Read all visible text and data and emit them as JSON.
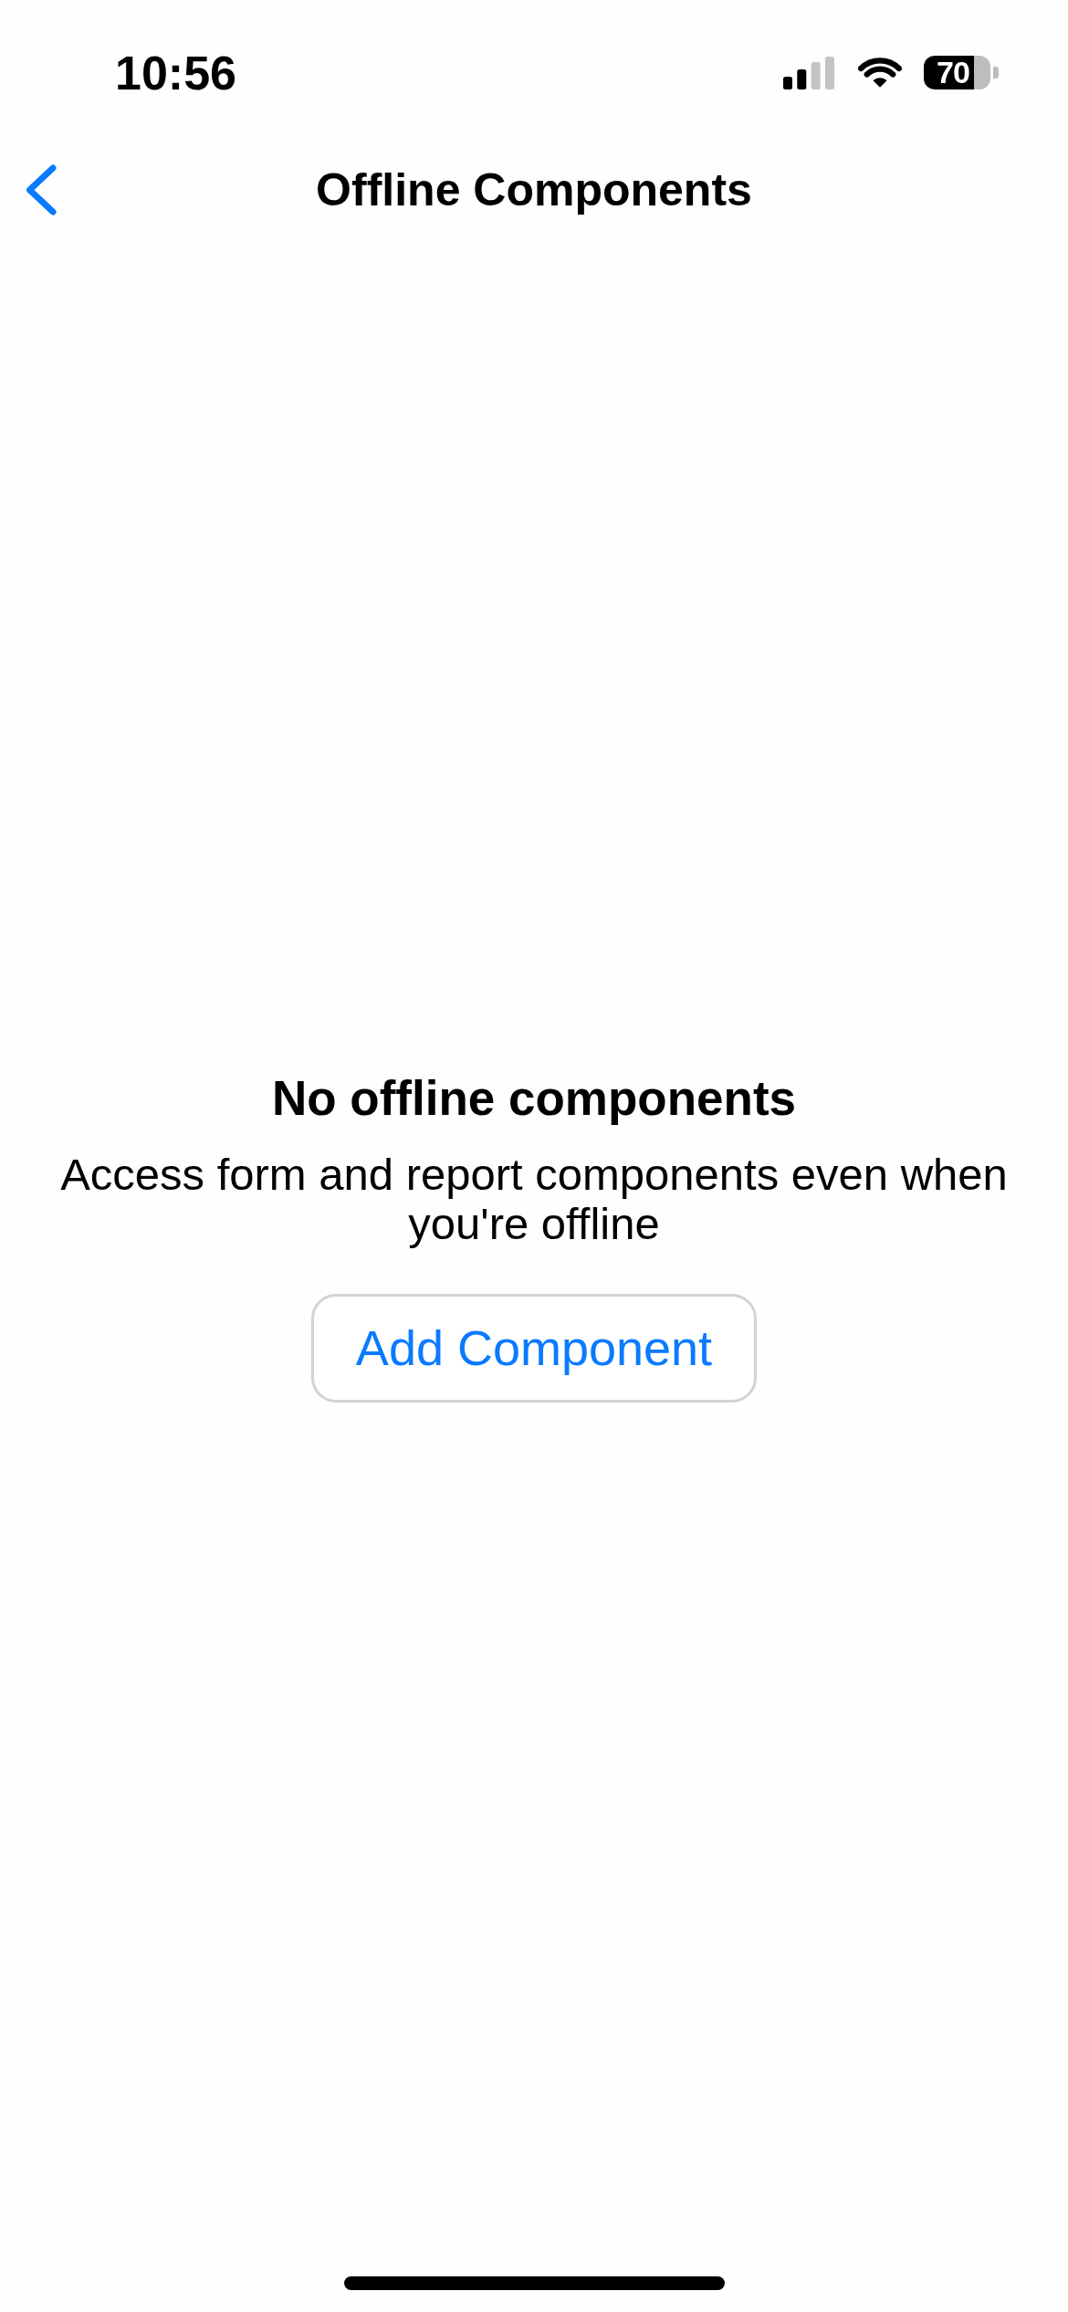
{
  "status_bar": {
    "time": "10:56",
    "battery": "70"
  },
  "nav_bar": {
    "title": "Offline Components"
  },
  "empty_state": {
    "heading": "No offline components",
    "message": "Access form and report components even when you're offline",
    "button": "Add Component"
  }
}
